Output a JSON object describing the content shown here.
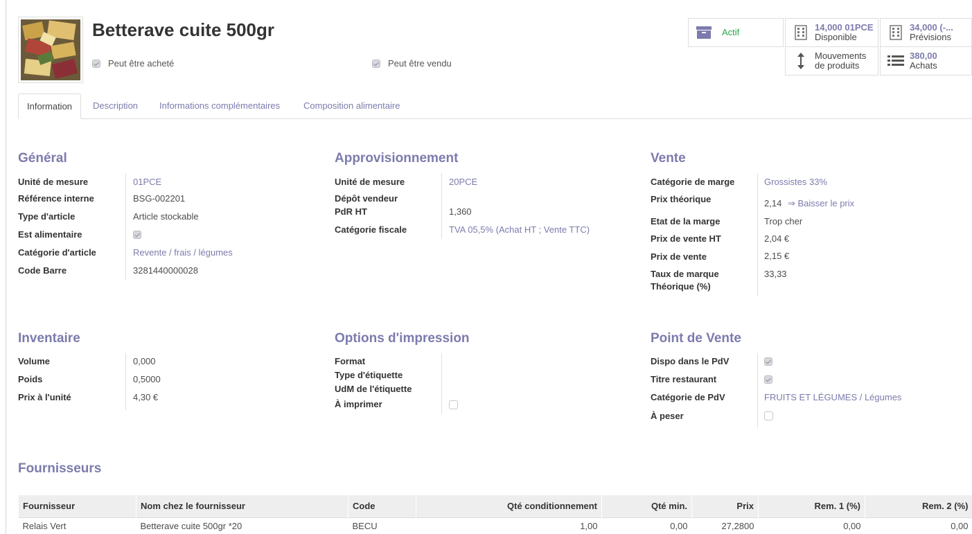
{
  "product": {
    "title": "Betterave cuite 500gr",
    "can_be_purchased_label": "Peut être acheté",
    "can_be_sold_label": "Peut être vendu"
  },
  "smart_buttons": {
    "active_label": "Actif",
    "available_value": "14,000 01PCE",
    "available_label": "Disponible",
    "forecast_value": "34,000 (-...",
    "forecast_label": "Prévisions",
    "moves_line1": "Mouvements",
    "moves_line2": "de produits",
    "purchases_value": "380,00",
    "purchases_label": "Achats"
  },
  "tabs": [
    {
      "label": "Information",
      "active": true
    },
    {
      "label": "Description"
    },
    {
      "label": "Informations complémentaires"
    },
    {
      "label": "Composition alimentaire"
    }
  ],
  "general": {
    "title": "Général",
    "uom_label": "Unité de mesure",
    "uom_value": "01PCE",
    "ref_label": "Référence interne",
    "ref_value": "BSG-002201",
    "type_label": "Type d'article",
    "type_value": "Article stockable",
    "food_label": "Est alimentaire",
    "categ_label": "Catégorie d'article",
    "categ_value": "Revente / frais / légumes",
    "barcode_label": "Code Barre",
    "barcode_value": "3281440000028"
  },
  "supply": {
    "title": "Approvisionnement",
    "uom_label": "Unité de mesure",
    "uom_value": "20PCE",
    "deposit_label": "Dépôt vendeur",
    "pdr_label": "PdR HT",
    "pdr_value": "1,360",
    "tax_label": "Catégorie fiscale",
    "tax_value": "TVA 05,5% (Achat HT ; Vente TTC)"
  },
  "sale": {
    "title": "Vente",
    "margin_cat_label": "Catégorie de marge",
    "margin_cat_value": "Grossistes 33%",
    "theo_price_label": "Prix théorique",
    "theo_price_value": "2,14",
    "lower_price_link": "⇒ Baisser le prix",
    "margin_state_label": "Etat de la marge",
    "margin_state_value": "Trop cher",
    "price_ht_label": "Prix de vente HT",
    "price_ht_value": "2,04 €",
    "price_label": "Prix de vente",
    "price_value": "2,15 €",
    "markup_label_1": "Taux de marque",
    "markup_label_2": "Théorique (%)",
    "markup_value": "33,33"
  },
  "inventory": {
    "title": "Inventaire",
    "volume_label": "Volume",
    "volume_value": "0,000",
    "weight_label": "Poids",
    "weight_value": "0,5000",
    "unit_price_label": "Prix à l'unité",
    "unit_price_value": "4,30 €"
  },
  "print": {
    "title": "Options d'impression",
    "format_label": "Format",
    "label_type_label": "Type d'étiquette",
    "label_uom_label": "UdM de l'étiquette",
    "to_print_label": "À imprimer"
  },
  "pos": {
    "title": "Point de Vente",
    "available_label": "Dispo dans le PdV",
    "meal_voucher_label": "Titre restaurant",
    "pos_categ_label": "Catégorie de PdV",
    "pos_categ_value": "FRUITS ET LÉGUMES / Légumes",
    "to_weigh_label": "À peser"
  },
  "suppliers": {
    "title": "Fournisseurs",
    "columns": [
      "Fournisseur",
      "Nom chez le fournisseur",
      "Code",
      "Qté conditionnement",
      "Qté min.",
      "Prix",
      "Rem. 1 (%)",
      "Rem. 2 (%)"
    ],
    "rows": [
      [
        "Relais Vert",
        "Betterave cuite 500gr *20",
        "BECU",
        "1,00",
        "0,00",
        "27,2800",
        "0,00",
        "0,00"
      ]
    ]
  },
  "colors": {
    "accent": "#7c7bad",
    "active_green": "#28a745",
    "archive_icon": "#7c7bad"
  }
}
